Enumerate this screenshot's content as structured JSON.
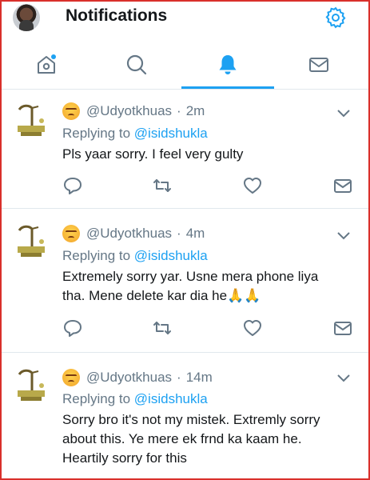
{
  "header": {
    "title": "Notifications"
  },
  "tabs": [
    {
      "icon": "home-icon",
      "active": false
    },
    {
      "icon": "search-icon",
      "active": false
    },
    {
      "icon": "bell-icon",
      "active": true
    },
    {
      "icon": "mail-icon",
      "active": false
    }
  ],
  "colors": {
    "accent": "#1da1f2",
    "secondary_text": "#657786",
    "frame": "#d9302b"
  },
  "tweets": [
    {
      "emoji": "angry-face",
      "handle": "@Udyotkhuas",
      "sep": "·",
      "time": "2m",
      "replying_prefix": "Replying to",
      "replying_to": "@isidshukla",
      "text": "Pls yaar sorry. I feel very gulty"
    },
    {
      "emoji": "angry-face",
      "handle": "@Udyotkhuas",
      "sep": "·",
      "time": "4m",
      "replying_prefix": "Replying to",
      "replying_to": "@isidshukla",
      "text_line1": "Extremely sorry yar. Usne mera phone liya",
      "text_line2": "tha. Mene delete kar dia he",
      "text_emoji": "🙏🙏"
    },
    {
      "emoji": "angry-face",
      "handle": "@Udyotkhuas",
      "sep": "·",
      "time": "14m",
      "replying_prefix": "Replying to",
      "replying_to": "@isidshukla",
      "text_line1": "Sorry bro it's not my mistek. Extremly sorry",
      "text_line2": "about this. Ye mere ek frnd ka kaam he.",
      "text_line3": "Heartily sorry for this"
    }
  ]
}
